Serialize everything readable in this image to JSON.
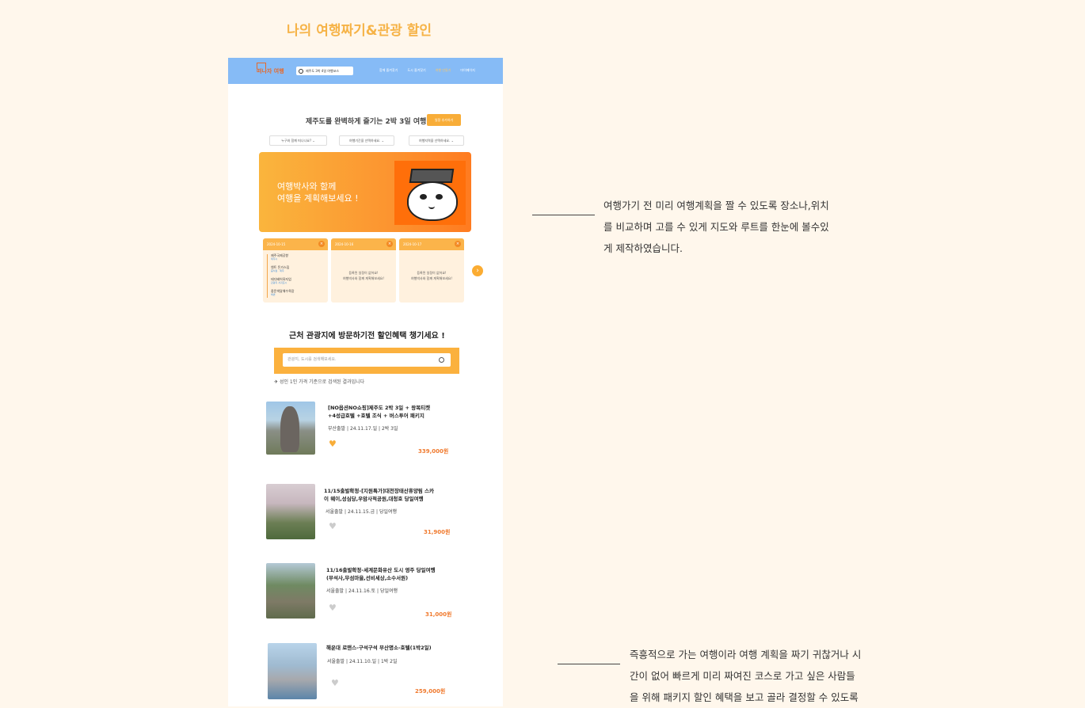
{
  "section_title": "나의 여행짜기&관광 할인",
  "header": {
    "logo": "떠나자 여행",
    "search_value": "제주도 3박 4일 여행코스",
    "nav": [
      "함께 즐겨찾기",
      "도시 즐겨찾기",
      "여행 만들기",
      "마이페이지"
    ]
  },
  "planner": {
    "title": "제주도를 완벽하게 즐기는 2박 3일 여행",
    "button": "일정 추가하기",
    "selects": [
      "누구와 함께 떠나나요? ⌄",
      "여행기간을 선택하세요. ⌄",
      "여행지역을 선택하세요. ⌄"
    ],
    "banner_line1": "여행박사와 함께",
    "banner_line2": "여행을 계획해보세요 !",
    "days": [
      {
        "label": "DAY1",
        "date": "2024-10-15",
        "stops": [
          {
            "name": "제주국제공항",
            "sub": "제주시"
          },
          {
            "name": "엔트 돈가스집",
            "sub": "음식점 · 제주"
          },
          {
            "name": "테디베어뮤지엄",
            "sub": "관광지 서귀포시"
          },
          {
            "name": "중문색달해수욕장",
            "sub": "해변"
          }
        ]
      },
      {
        "label": "DAY2",
        "date": "2024-10-16",
        "empty1": "등록된 일정이 없어요!",
        "empty2": "여행박사와 함께 계획해보세요!"
      },
      {
        "label": "DAY3",
        "date": "2024-10-17",
        "empty1": "등록된 일정이 없어요!",
        "empty2": "여행박사와 함께 계획해보세요!"
      }
    ]
  },
  "deals": {
    "title": "근처 관광지에 방문하기전 할인혜택 챙기세요 !",
    "search_placeholder": "관광지, 도시를 검색해보세요.",
    "basis": "성인 1인 가격 기준으로 검색된 결과입니다",
    "products": [
      {
        "title1": "[NO옵션NO쇼핑]제주도 2박 3일 + 왕복티켓",
        "title2": "+4성급호텔 +호텔 조식 + 버스투어 패키지",
        "depart": "부산출발",
        "date": "24.11.17.일",
        "duration": "2박 3일",
        "price": "339,000원",
        "liked": true
      },
      {
        "title1": "11/15출발확정-[지원특가]대전장태산휴양림 스카",
        "title2": "이 웨이,성심당,우암사적공원,대청호 당일여행",
        "depart": "서울출발",
        "date": "24.11.15.금",
        "duration": "당일여행",
        "price": "31,900원",
        "liked": false
      },
      {
        "title1": "11/16출발확정-세계문화유산 도시 영주 당일여행",
        "title2": "(부석사,무섬마을,선비세상,소수서원)",
        "depart": "서울출발",
        "date": "24.11.16.토",
        "duration": "당일여행",
        "price": "31,000원",
        "liked": false
      },
      {
        "title1": "해운대 로맨스-구석구석 부산명소-호텔(1박2일)",
        "title2": "",
        "depart": "서울출발",
        "date": "24.11.10.일",
        "duration": "1박 2일",
        "price": "259,000원",
        "liked": false
      }
    ]
  },
  "descriptions": {
    "first": [
      "여행가기 전  미리 여행계획을 짤 수 있도록 장소나,위치",
      "를 비교하며 고를 수 있게 지도와 루트를 한눈에 볼수있",
      "게 제작하였습니다."
    ],
    "second": [
      "즉흥적으로 가는 여행이라 여행 계획을 짜기 귀찮거나 시",
      "간이 없어 빠르게 미리 짜여진 코스로 가고 싶은 사람들",
      "을 위해 패키지 할인 혜택을 보고 골라 결정할 수 있도록"
    ]
  },
  "colors": {
    "background": "#fff7ec",
    "accent": "#f8ad38",
    "header": "#86bbf6",
    "price": "#f07a2e"
  }
}
